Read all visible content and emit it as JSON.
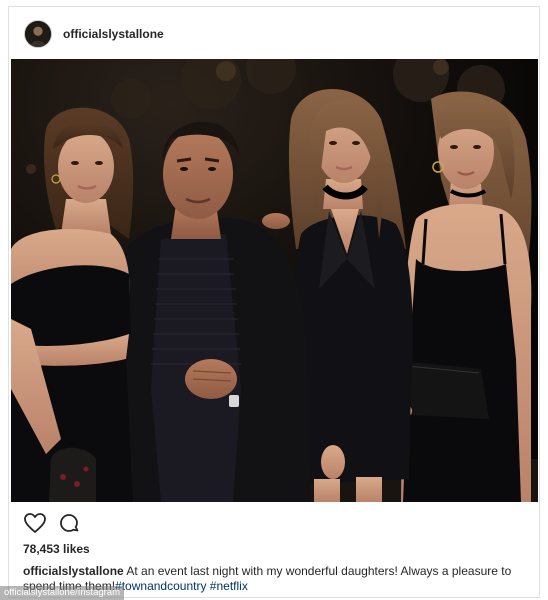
{
  "post": {
    "header": {
      "avatar_icon": "profile-avatar",
      "username": "officialslystallone"
    },
    "photo": {
      "subject": "group-photo"
    },
    "actions": {
      "like_icon": "heart-icon",
      "comment_icon": "comment-icon"
    },
    "likes_text": "78,453 likes",
    "caption": {
      "username": "officialslystallone",
      "text_before": " At an event last night with my wonderful daughters! Always a pleasure to spend time them!",
      "hashtag_1": "#townandcountry",
      "hashtag_2": "#netflix"
    }
  },
  "credit": "officialslystallone/Instagram",
  "colors": {
    "text": "#262626",
    "hashtag": "#003569",
    "border": "#e0e0e0"
  }
}
